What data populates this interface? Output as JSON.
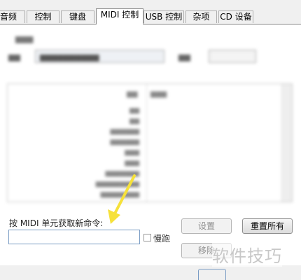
{
  "tabs": [
    {
      "label": "音频"
    },
    {
      "label": "控制"
    },
    {
      "label": "键盘"
    },
    {
      "label": "MIDI 控制"
    },
    {
      "label": "USB 控制"
    },
    {
      "label": "杂项"
    },
    {
      "label": "CD 设备"
    }
  ],
  "active_tab": "MIDI 控制",
  "midi": {
    "get_command_label": "按 MIDI 单元获取新命令:",
    "command_input_value": "",
    "slow_label": "慢跑",
    "set_button": "设置",
    "reset_all_button": "重置所有",
    "remove_button": "移除"
  },
  "watermark": "软件技巧",
  "colors": {
    "arrow": "#f6e13a",
    "input_border": "#7a9cc4"
  }
}
